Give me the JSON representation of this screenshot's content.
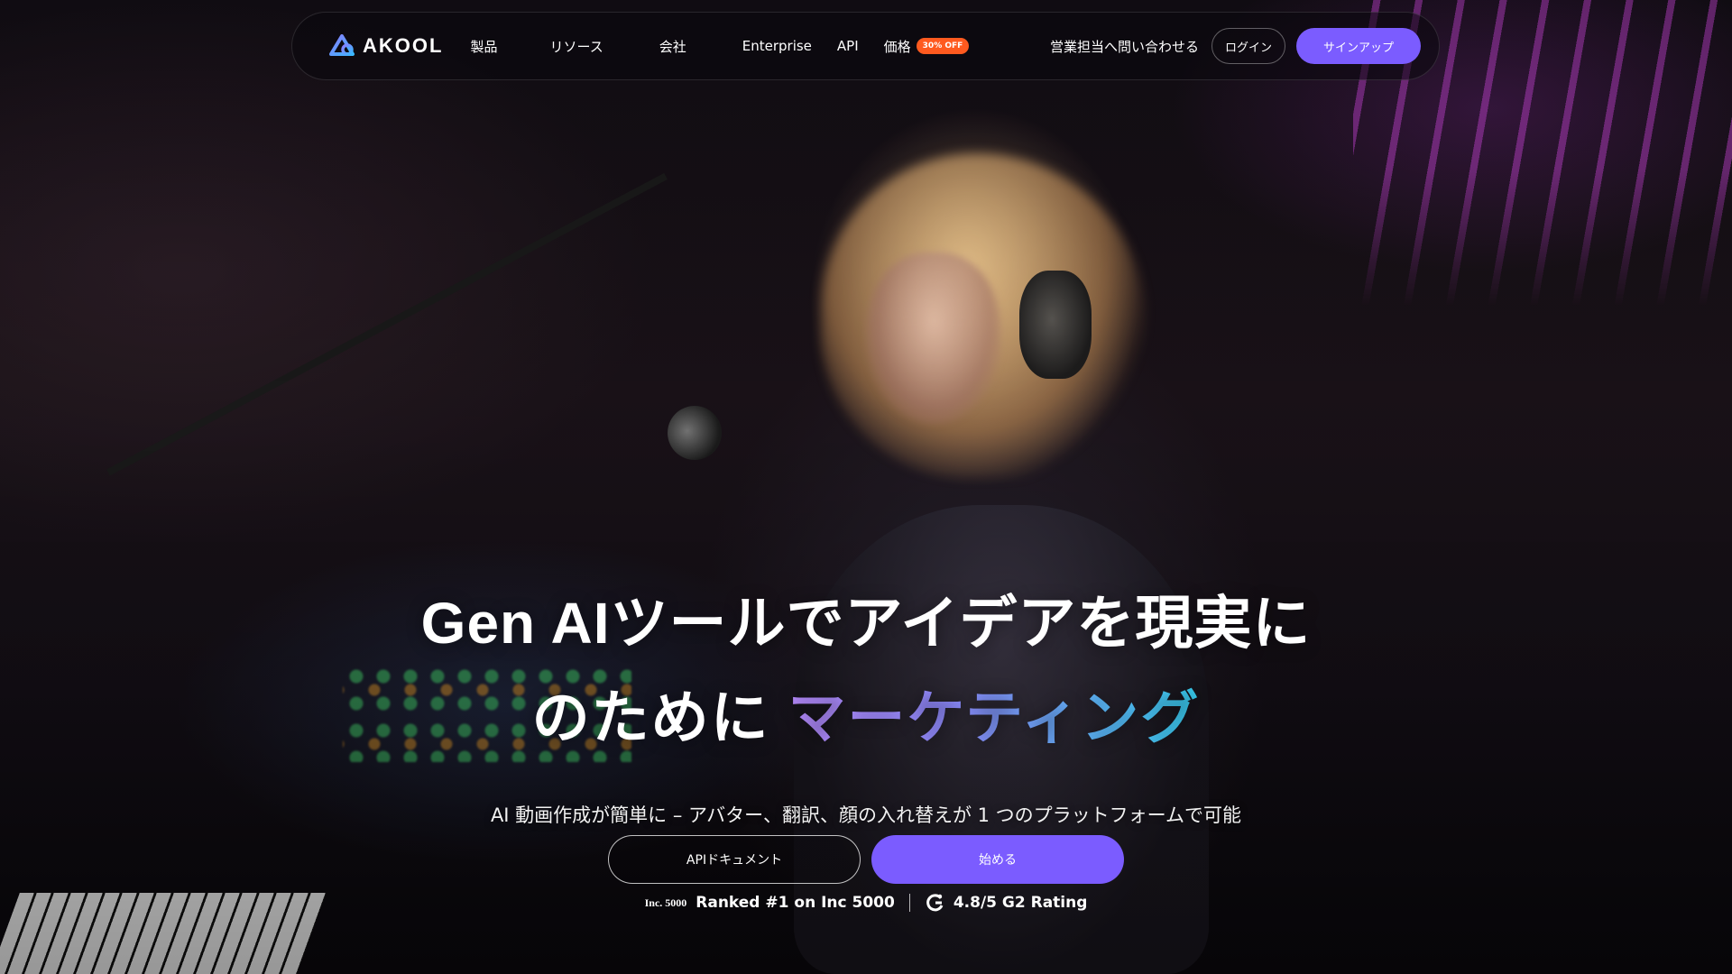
{
  "brand": {
    "name": "AKOOL",
    "accent_color": "#7b5cff",
    "badge_color": "#ff5a1f"
  },
  "nav": {
    "items": [
      {
        "label": "製品"
      },
      {
        "label": "リソース"
      },
      {
        "label": "会社"
      },
      {
        "label": "Enterprise"
      },
      {
        "label": "API"
      },
      {
        "label": "価格",
        "badge": "30% OFF"
      }
    ],
    "contact_label": "営業担当へ問い合わせる",
    "login_label": "ログイン",
    "signup_label": "サインアップ"
  },
  "hero": {
    "headline_line1": "Gen AIツールでアイデアを現実に",
    "headline_line2_prefix": "のために",
    "headline_line2_accent": "マーケティング",
    "subtitle": "AI 動画作成が簡単に – アバター、翻訳、顔の入れ替えが 1 つのプラットフォームで可能",
    "cta_secondary": "APIドキュメント",
    "cta_primary": "始める",
    "proof": {
      "inc_logo_text": "Inc. 5000",
      "inc_text": "Ranked #1 on Inc 5000",
      "g2_icon": "g2-icon",
      "g2_text": "4.8/5 G2 Rating"
    }
  }
}
